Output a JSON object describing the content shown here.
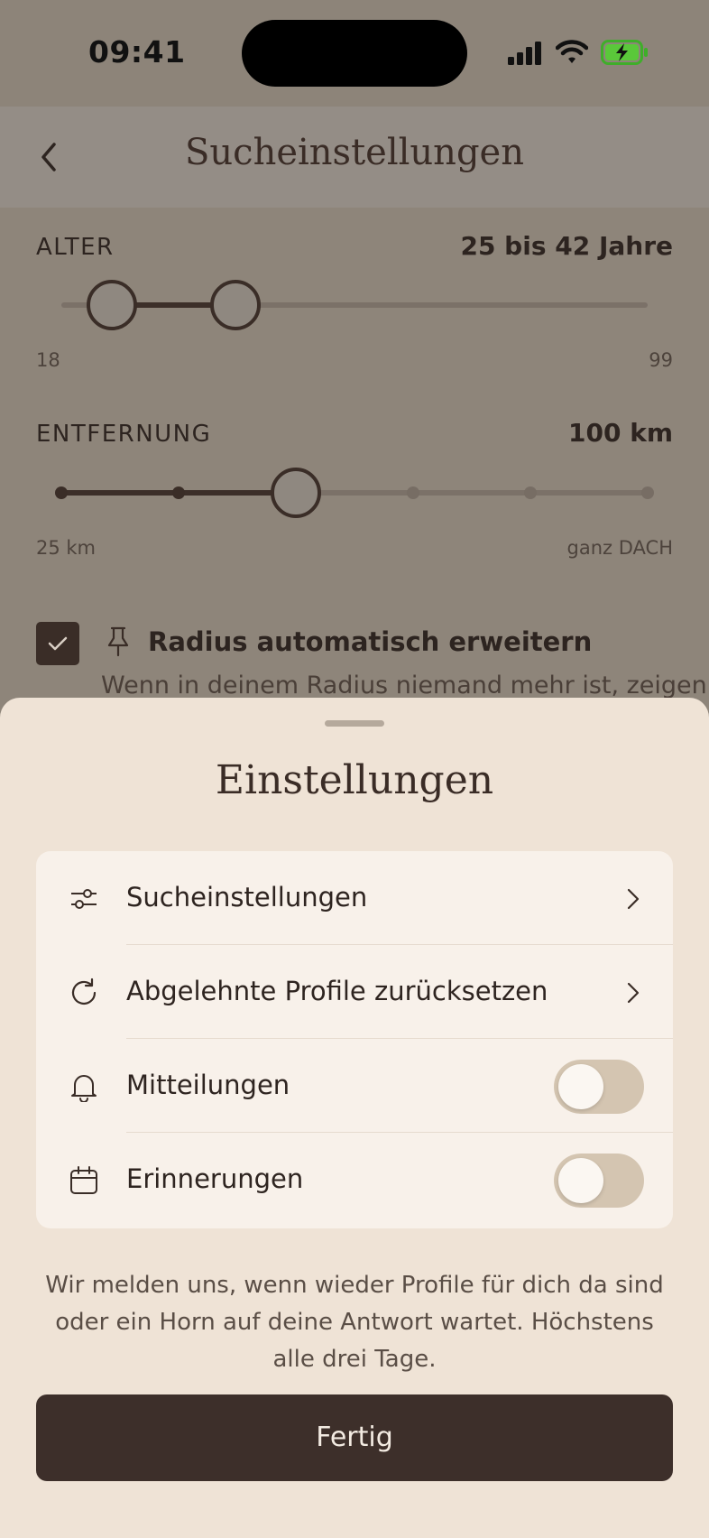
{
  "status_bar": {
    "time": "09:41"
  },
  "nav": {
    "title": "Sucheinstellungen"
  },
  "age": {
    "label": "ALTER",
    "value": "25 bis 42 Jahre",
    "min_label": "18",
    "max_label": "99",
    "range_min": 18,
    "range_max": 99,
    "low": 25,
    "high": 42
  },
  "distance": {
    "label": "ENTFERNUNG",
    "value": "100 km",
    "min_label": "25 km",
    "max_label": "ganz DACH",
    "steps": 6,
    "selected_step": 3
  },
  "radius": {
    "checked": true,
    "title": "Radius automatisch erweitern",
    "description": "Wenn in deinem Radius niemand mehr ist, zeigen"
  },
  "sheet": {
    "title": "Einstellungen",
    "rows": [
      {
        "label": "Sucheinstellungen",
        "icon": "sliders-icon",
        "control": "chevron"
      },
      {
        "label": "Abgelehnte Profile zurücksetzen",
        "icon": "refresh-icon",
        "control": "chevron"
      },
      {
        "label": "Mitteilungen",
        "icon": "bell-icon",
        "control": "toggle",
        "on": false
      },
      {
        "label": "Erinnerungen",
        "icon": "calendar-icon",
        "control": "toggle",
        "on": false
      }
    ],
    "info": "Wir melden uns, wenn wieder Profile für dich da sind oder ein Horn auf deine Antwort wartet. Höchstens alle drei Tage.",
    "done_label": "Fertig"
  },
  "colors": {
    "accent_dark": "#3d2f2a",
    "sheet_bg": "#efe3d6",
    "card_bg": "#f8f1ea",
    "toggle_off": "#d4c5b1",
    "battery_green": "#5ac83a"
  }
}
